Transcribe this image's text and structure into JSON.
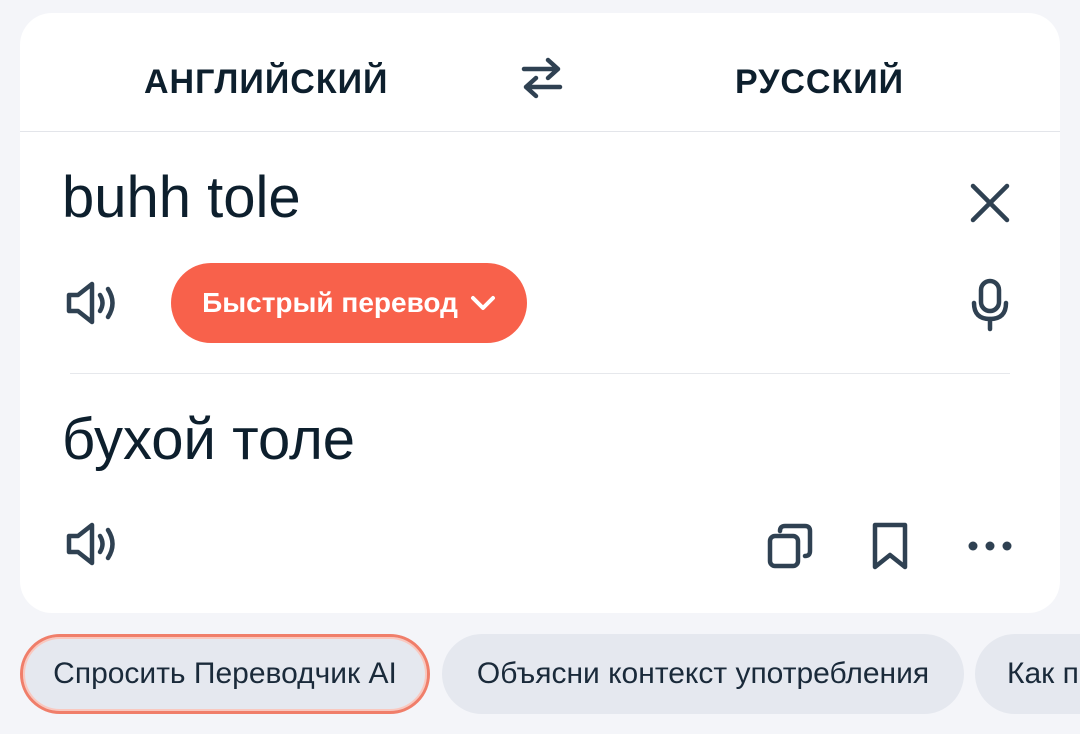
{
  "header": {
    "source_lang": "АНГЛИЙСКИЙ",
    "target_lang": "РУССКИЙ",
    "swap_icon": "swap-arrows-icon"
  },
  "source": {
    "text": "buhh tole",
    "clear_icon": "close-icon",
    "speaker_icon": "speaker-icon",
    "mic_icon": "microphone-icon"
  },
  "mode": {
    "label": "Быстрый перевод",
    "chevron_icon": "chevron-down-icon"
  },
  "target": {
    "text": "бухой толе",
    "speaker_icon": "speaker-icon",
    "copy_icon": "copy-icon",
    "bookmark_icon": "bookmark-icon",
    "more_icon": "more-dots-icon"
  },
  "suggestions": [
    {
      "label": "Спросить Переводчик AI"
    },
    {
      "label": "Объясни контекст употребления"
    },
    {
      "label": "Как п"
    }
  ],
  "colors": {
    "accent": "#f8614b",
    "text": "#0d1f2d",
    "icon": "#2f4152",
    "background": "#f4f5f9",
    "chip": "#e5e8ef"
  }
}
